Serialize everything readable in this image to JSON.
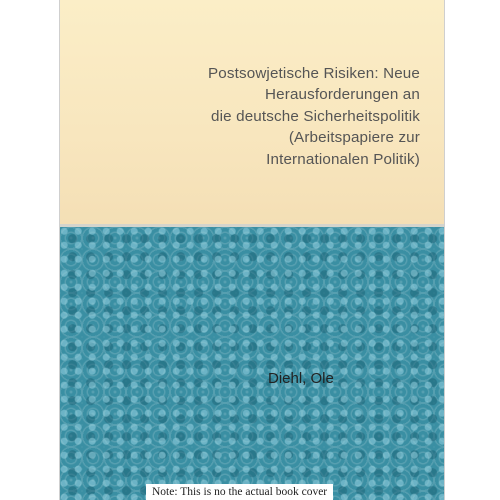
{
  "cover": {
    "title": "Postsowjetische Risiken: Neue Herausforderungen an\ndie deutsche Sicherheitspolitik\n(Arbeitspapiere zur\nInternationalen Politik)",
    "author": "Diehl, Ole",
    "top_color": "#f8e6be",
    "bottom_color": "#3a8fa3"
  },
  "note": "Note: This is no the actual book cover"
}
